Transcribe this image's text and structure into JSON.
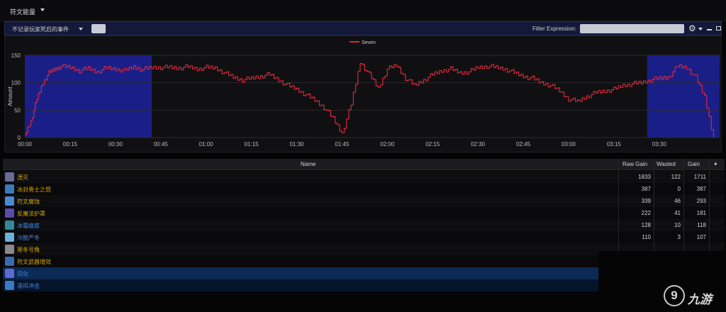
{
  "app": {
    "title": "符文能量"
  },
  "filterbar": {
    "dropdown": "不记录玩家死后的事件",
    "filter_label": "Filter Expression:",
    "filter_value": ""
  },
  "chart_data": {
    "type": "line",
    "xlabel": "",
    "ylabel": "Amount",
    "ylim": [
      0,
      150
    ],
    "yticks": [
      0,
      50,
      100,
      150
    ],
    "xlim": [
      0,
      230
    ],
    "xticks": [
      0,
      15,
      30,
      45,
      60,
      75,
      90,
      105,
      120,
      135,
      150,
      165,
      180,
      195,
      210,
      225
    ],
    "xtick_labels": [
      "00:00",
      "00:15",
      "00:30",
      "00:45",
      "01:00",
      "01:15",
      "01:30",
      "01:45",
      "02:00",
      "02:15",
      "02:30",
      "02:45",
      "03:00",
      "03:15",
      "03:30"
    ],
    "legend": "top-center",
    "highlight_ranges": [
      [
        0,
        42
      ],
      [
        206,
        230
      ]
    ],
    "highlight_color": "#1a1f88",
    "line_color": "#d4283a",
    "series": [
      {
        "name": "Seven",
        "x": [
          0,
          2,
          4,
          6,
          8,
          10,
          12,
          15,
          18,
          21,
          24,
          27,
          30,
          33,
          36,
          39,
          42,
          45,
          48,
          51,
          54,
          57,
          60,
          63,
          66,
          69,
          72,
          75,
          78,
          81,
          84,
          87,
          90,
          93,
          96,
          99,
          102,
          105,
          108,
          111,
          114,
          117,
          120,
          123,
          126,
          129,
          132,
          135,
          138,
          141,
          144,
          147,
          150,
          153,
          156,
          159,
          162,
          165,
          168,
          171,
          174,
          177,
          180,
          183,
          186,
          189,
          192,
          195,
          198,
          201,
          204,
          207,
          210,
          213,
          216,
          219,
          222,
          225,
          228
        ],
        "values": [
          5,
          30,
          70,
          100,
          118,
          125,
          130,
          128,
          122,
          126,
          120,
          127,
          125,
          122,
          129,
          124,
          128,
          128,
          128,
          127,
          129,
          125,
          128,
          127,
          118,
          110,
          105,
          108,
          112,
          115,
          105,
          95,
          88,
          78,
          68,
          55,
          35,
          8,
          60,
          138,
          115,
          90,
          125,
          132,
          108,
          95,
          105,
          115,
          122,
          125,
          118,
          120,
          128,
          130,
          128,
          125,
          118,
          112,
          108,
          100,
          95,
          85,
          70,
          66,
          75,
          82,
          85,
          88,
          95,
          98,
          100,
          105,
          108,
          110,
          130,
          128,
          110,
          75,
          0
        ]
      }
    ]
  },
  "table": {
    "headers": {
      "name": "Name",
      "raw": "Raw Gain",
      "wasted": "Wasted",
      "gain": "Gain",
      "star": "✦"
    },
    "rows": [
      {
        "name": "湮灭",
        "raw": "1833",
        "wasted": "122",
        "gain": "1711",
        "color": "gold",
        "icon": "#6a6a96"
      },
      {
        "name": "冰封勇士之怒",
        "raw": "387",
        "wasted": "0",
        "gain": "387",
        "color": "gold",
        "icon": "#3b7ab8"
      },
      {
        "name": "符文腐蚀",
        "raw": "339",
        "wasted": "46",
        "gain": "293",
        "color": "gold",
        "icon": "#4a8ad0"
      },
      {
        "name": "反魔法护罩",
        "raw": "222",
        "wasted": "41",
        "gain": "181",
        "color": "gold",
        "icon": "#5a4aa8"
      },
      {
        "name": "冰霜瘟疫",
        "raw": "128",
        "wasted": "10",
        "gain": "118",
        "color": "blue",
        "icon": "#2f8a9a"
      },
      {
        "name": "冷酷严冬",
        "raw": "110",
        "wasted": "3",
        "gain": "107",
        "color": "blue",
        "icon": "#6ab0d8"
      },
      {
        "name": "寒冬号角",
        "raw": "",
        "wasted": "",
        "gain": "",
        "color": "gold",
        "icon": "#8a8a8a"
      },
      {
        "name": "符文武器增效",
        "raw": "",
        "wasted": "",
        "gain": "",
        "color": "gold",
        "icon": "#3a6ab0"
      },
      {
        "name": "冈化",
        "raw": "",
        "wasted": "",
        "gain": "",
        "color": "blue",
        "icon": "#5a6ad8"
      },
      {
        "name": "凛风冲击",
        "raw": "",
        "wasted": "",
        "gain": "",
        "color": "blue",
        "icon": "#3a78c8"
      }
    ]
  },
  "watermark": {
    "glyph": "9",
    "text": "九游"
  }
}
